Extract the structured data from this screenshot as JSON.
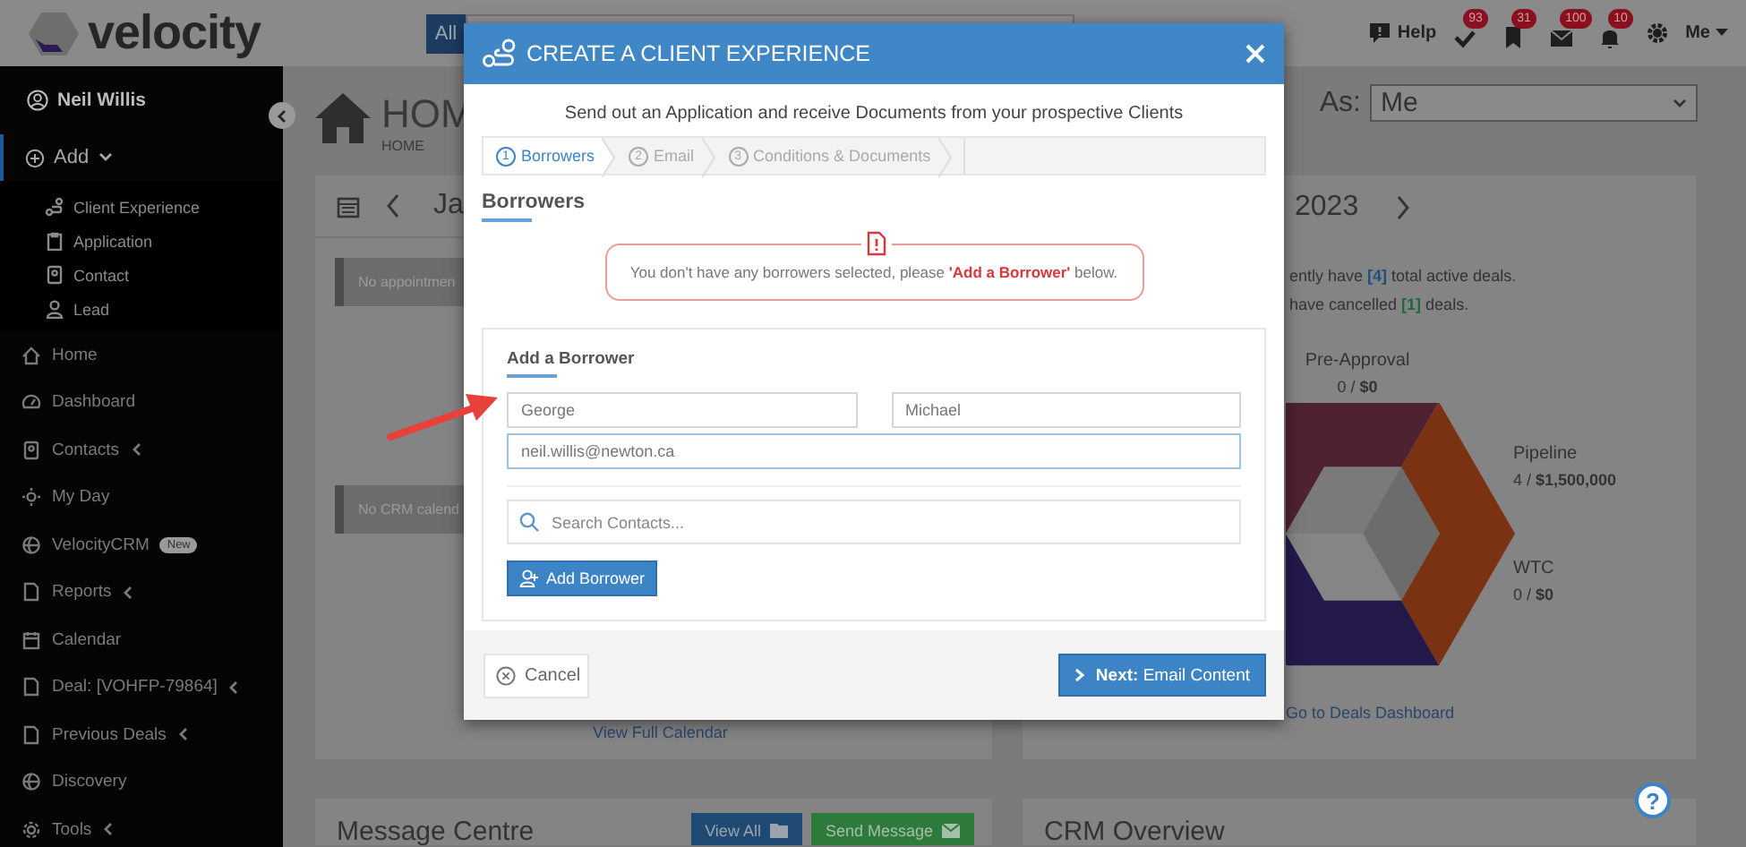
{
  "header": {
    "logo_text": "velocity",
    "search_scope_button": "All",
    "help_label": "Help",
    "badges": [
      {
        "kind": "check",
        "count": "93"
      },
      {
        "kind": "bookmark",
        "count": "31"
      },
      {
        "kind": "envelope",
        "count": "100"
      },
      {
        "kind": "bell",
        "count": "10"
      }
    ],
    "user_menu": "Me"
  },
  "sidebar": {
    "user_name": "Neil Willis",
    "add_menu": {
      "label": "Add",
      "expanded": true,
      "children": [
        {
          "kind": "route",
          "label": "Client Experience"
        },
        {
          "kind": "clipboard",
          "label": "Application"
        },
        {
          "kind": "card",
          "label": "Contact"
        },
        {
          "kind": "person",
          "label": "Lead"
        }
      ]
    },
    "items": [
      {
        "kind": "house",
        "label": "Home",
        "has_submenu": false
      },
      {
        "kind": "gauge",
        "label": "Dashboard",
        "has_submenu": false
      },
      {
        "kind": "card",
        "label": "Contacts",
        "has_submenu": true
      },
      {
        "kind": "sun",
        "label": "My Day",
        "has_submenu": false
      },
      {
        "kind": "globe",
        "label": "VelocityCRM",
        "badge": "New",
        "has_submenu": false
      },
      {
        "kind": "document",
        "label": "Reports",
        "has_submenu": true
      },
      {
        "kind": "calendar",
        "label": "Calendar",
        "has_submenu": false
      },
      {
        "kind": "document",
        "label": "Deal: [VOHFP-79864]",
        "has_submenu": true
      },
      {
        "kind": "document",
        "label": "Previous Deals",
        "has_submenu": true
      },
      {
        "kind": "globe",
        "label": "Discovery",
        "has_submenu": false
      },
      {
        "kind": "gear",
        "label": "Tools",
        "has_submenu": true
      }
    ]
  },
  "page": {
    "title": "HOM",
    "breadcrumb": "HOME",
    "view_as": {
      "label": "As:",
      "value": "Me"
    }
  },
  "calendar_card": {
    "month": "Ja",
    "notices": [
      "No appointmen",
      "No CRM calend"
    ],
    "link": "View Full Calendar"
  },
  "deals_card": {
    "year": "2023",
    "summary": [
      {
        "text": "ently have **[4]** total active deals.",
        "color": "#1e4f82"
      },
      {
        "text": "have cancelled **[1]** deals.",
        "color": "#1f6a3c"
      }
    ],
    "stages": [
      {
        "name": "Pre-Approval",
        "value": "0 / **$0**"
      },
      {
        "name": "Pipeline",
        "value": "4 / **$1,500,000**"
      },
      {
        "name": "WTC",
        "value": "0 / **$0**"
      }
    ],
    "link": "Go to Deals Dashboard"
  },
  "message_centre": {
    "title": "Message Centre",
    "buttons": [
      {
        "kind": "view-all",
        "label": "View All"
      },
      {
        "kind": "send-message",
        "label": "Send Message"
      }
    ]
  },
  "crm_overview": {
    "title": "CRM Overview"
  },
  "help_button": "?",
  "modal": {
    "title": "CREATE A CLIENT EXPERIENCE",
    "subtitle": "Send out an Application and receive Documents from your prospective Clients",
    "steps": [
      {
        "number": "1",
        "label": "Borrowers",
        "selected": true
      },
      {
        "number": "2",
        "label": "Email",
        "selected": false
      },
      {
        "number": "3",
        "label": "Conditions & Documents",
        "selected": false
      }
    ],
    "section_title": "Borrowers",
    "alert": "You don't have any borrowers selected, please **'Add a Borrower'** below.",
    "add_panel": {
      "title": "Add a Borrower",
      "first_name": {
        "value": "George",
        "focused": false
      },
      "last_name": {
        "value": "Michael",
        "focused": false
      },
      "email": {
        "value": "neil.willis@newton.ca",
        "focused": true
      },
      "search": {
        "placeholder": "Search Contacts..."
      },
      "add_button": "Add Borrower"
    },
    "cancel_button": "Cancel",
    "next_button": "**Next:** Email Content"
  }
}
